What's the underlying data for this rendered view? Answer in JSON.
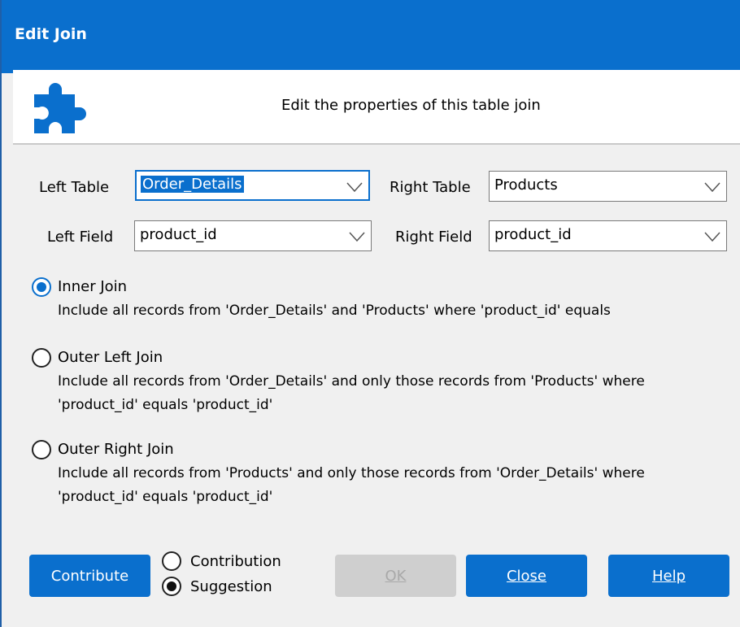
{
  "window": {
    "title": "Edit Join"
  },
  "header": {
    "icon": "puzzle-icon",
    "description": "Edit the properties of this table join"
  },
  "fields": {
    "left_table": {
      "label": "Left Table",
      "value": "Order_Details"
    },
    "right_table": {
      "label": "Right Table",
      "value": "Products"
    },
    "left_field": {
      "label": "Left Field",
      "value": "product_id"
    },
    "right_field": {
      "label": "Right Field",
      "value": "product_id"
    }
  },
  "join_options": [
    {
      "title": "Inner Join",
      "selected": true,
      "desc_lines": [
        "Include all records from 'Order_Details' and 'Products' where 'product_id' equals"
      ]
    },
    {
      "title": "Outer Left Join",
      "selected": false,
      "desc_lines": [
        "Include all records from 'Order_Details' and only those records from 'Products' where",
        "'product_id' equals 'product_id'"
      ]
    },
    {
      "title": "Outer Right Join",
      "selected": false,
      "desc_lines": [
        "Include all records from 'Products' and only those records from 'Order_Details' where",
        "'product_id' equals 'product_id'"
      ]
    }
  ],
  "contribute": {
    "button_label": "Contribute",
    "options": [
      {
        "label": "Contribution",
        "selected": false
      },
      {
        "label": "Suggestion",
        "selected": true
      }
    ]
  },
  "buttons": {
    "ok": {
      "label": "OK",
      "enabled": false
    },
    "close": {
      "label": "Close"
    },
    "help": {
      "label": "Help"
    }
  },
  "colors": {
    "accent": "#0a6fcd",
    "title_bar": "#0a6fcd",
    "dialog_bg": "#f0f0f0",
    "disabled": "#cfcfcf"
  }
}
